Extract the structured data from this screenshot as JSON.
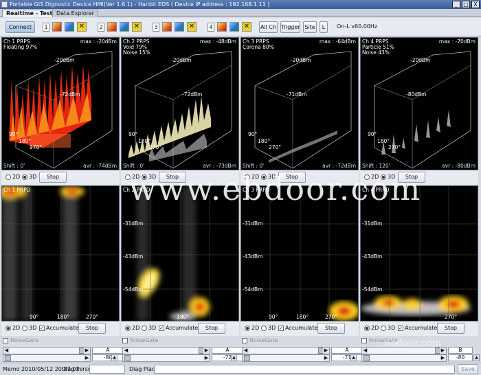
{
  "window": {
    "title": "Portable GIS Dignostic Device HMI(Ver 1.6.1) - Hanbit EDS ( Device IP address : 192.168.1.11 )",
    "minimize": "_",
    "maximize": "□",
    "close": "X"
  },
  "tabs": [
    "Realtime - Test_Lab",
    "Data Explorer"
  ],
  "toolbar": {
    "connect": "Connect",
    "channels": [
      "1",
      "2",
      "3",
      "4"
    ],
    "all_ch": "All Ch",
    "trigger": "Trigger",
    "site": "Site",
    "l": "L",
    "online": "On-L v60.00Hz"
  },
  "prps": [
    {
      "title": "Ch 1 PRPS",
      "max": "max : -20dBm",
      "line1": "Floating 97%",
      "line2": "",
      "top_scale": "-20dBm",
      "mid_scale": "-72dBm",
      "shift": "Shift : 0'",
      "avr": "avr : -74dBm",
      "deg1": "90°",
      "deg2": "180°",
      "deg3": "270°"
    },
    {
      "title": "Ch 2 PRPS",
      "max": "max : -48dBm",
      "line1": "Void 79%",
      "line2": "Noise 15%",
      "top_scale": "-20dBm",
      "mid_scale": "-72dBm",
      "shift": "Shift : 0'",
      "avr": "avr : -73dBm",
      "deg1": "90°",
      "deg2": "180°",
      "deg3": "270°"
    },
    {
      "title": "Ch 3 PRPS",
      "max": "max : -64dBm",
      "line1": "Corona 80%",
      "line2": "",
      "top_scale": "-20dBm",
      "mid_scale": "-71dBm",
      "shift": "Shift : 0'",
      "avr": "avr : -72dBm",
      "deg1": "90°",
      "deg2": "180°",
      "deg3": "270°"
    },
    {
      "title": "Ch 4 PRPS",
      "max": "max : -70dBm",
      "line1": "Particle 51%",
      "line2": "Noise 43%",
      "top_scale": "-20dBm",
      "mid_scale": "-80dBm",
      "shift": "Shift : 120'",
      "avr": "avr : -80dBm",
      "deg1": "90°",
      "deg2": "180°",
      "deg3": "270°"
    }
  ],
  "prpd": [
    {
      "title": "Ch 1 PRPD",
      "y1": "-31dBm",
      "y2": "-43dBm",
      "y3": "-54dBm",
      "x1": "90°",
      "x2": "180°",
      "x3": "270°"
    },
    {
      "title": "Ch 2 PRPD",
      "y1": "-31dBm",
      "y2": "-43dBm",
      "y3": "-54dBm",
      "x1": "90°",
      "x2": "180°",
      "x3": "270°"
    },
    {
      "title": "Ch 3 PRPD",
      "y1": "-31dBm",
      "y2": "-43dBm",
      "y3": "-54dBm",
      "x1": "90°",
      "x2": "180°",
      "x3": "270°"
    },
    {
      "title": "Ch 4 PRPD",
      "y1": "-31dBm",
      "y2": "-43dBm",
      "y3": "-54dBm",
      "x1": "90°",
      "x2": "180°",
      "x3": "270°"
    }
  ],
  "controls": {
    "two_d": "2D",
    "three_d": "3D",
    "stop": "Stop",
    "accumulate": "Accumulate",
    "noisegate": "NoiseGate"
  },
  "gates": [
    {
      "mode": "A",
      "value": "-80"
    },
    {
      "mode": "A",
      "value": "-72"
    },
    {
      "mode": "A",
      "value": "-71"
    },
    {
      "mode": "B",
      "value": "-80"
    }
  ],
  "status": {
    "memo": "Memo 2010/05/12 20:07:01",
    "diag_person": "Diag Person",
    "diag_place": "Diag Place",
    "save": "Save"
  },
  "watermark": "www.ebdoor.com",
  "watermark_small": "ebdoor.com",
  "colors": {
    "title_bar": "#3a5d99",
    "panel_bg": "#000000",
    "heat_hot": "#ffee22",
    "heat_red": "#e01010"
  }
}
